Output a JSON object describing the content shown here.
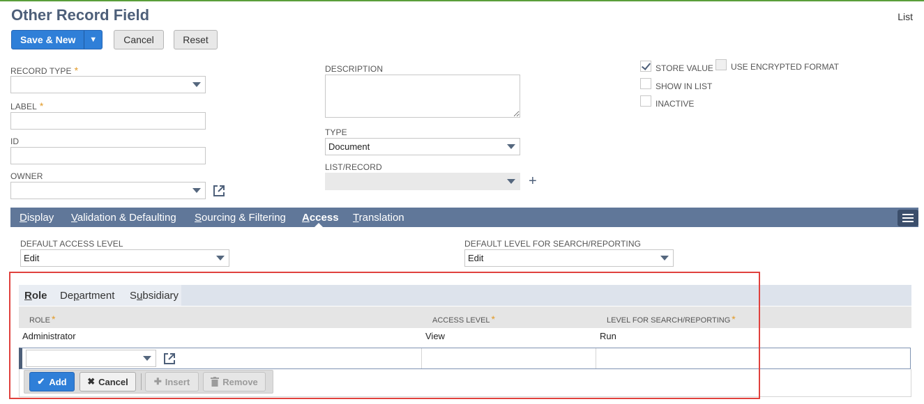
{
  "header": {
    "title": "Other Record Field",
    "list_link": "List"
  },
  "toolbar": {
    "save_new": "Save & New",
    "save_dropdown": "▼",
    "cancel": "Cancel",
    "reset": "Reset"
  },
  "fields": {
    "record_type": {
      "label": "RECORD TYPE",
      "required": "*",
      "value": ""
    },
    "label": {
      "label": "LABEL",
      "required": "*",
      "value": ""
    },
    "id": {
      "label": "ID",
      "value": ""
    },
    "owner": {
      "label": "OWNER",
      "value": ""
    },
    "description": {
      "label": "DESCRIPTION",
      "value": ""
    },
    "type": {
      "label": "TYPE",
      "value": "Document"
    },
    "list_record": {
      "label": "LIST/RECORD",
      "value": ""
    }
  },
  "checkboxes": {
    "store_value": {
      "label": "STORE VALUE",
      "checked": true
    },
    "use_encrypted": {
      "label": "USE ENCRYPTED FORMAT",
      "checked": false
    },
    "show_in_list": {
      "label": "SHOW IN LIST",
      "checked": false
    },
    "inactive": {
      "label": "INACTIVE",
      "checked": false
    }
  },
  "tabs": [
    {
      "first": "D",
      "rest": "isplay"
    },
    {
      "first": "V",
      "rest": "alidation & Defaulting"
    },
    {
      "first": "S",
      "rest": "ourcing & Filtering"
    },
    {
      "first": "A",
      "rest": "ccess"
    },
    {
      "first": "T",
      "rest": "ranslation"
    }
  ],
  "active_tab": "Access",
  "access": {
    "default_access_level": {
      "label": "DEFAULT ACCESS LEVEL",
      "value": "Edit"
    },
    "default_search_level": {
      "label": "DEFAULT LEVEL FOR SEARCH/REPORTING",
      "value": "Edit"
    },
    "subtabs": [
      {
        "first": "R",
        "rest": "ole"
      },
      {
        "pre": "De",
        "u": "p",
        "rest": "artment"
      },
      {
        "pre": "S",
        "u": "u",
        "rest": "bsidiary"
      }
    ],
    "columns": {
      "role": "ROLE",
      "access_level": "ACCESS LEVEL",
      "search_level": "LEVEL FOR SEARCH/REPORTING",
      "required": "*"
    },
    "rows": [
      {
        "role": "Administrator",
        "access_level": "View",
        "search_level": "Run"
      }
    ],
    "machine_buttons": {
      "add": "Add",
      "cancel": "Cancel",
      "insert": "Insert",
      "remove": "Remove"
    }
  },
  "colors": {
    "accent": "#2f7fd8",
    "tabbar": "#607799",
    "highlight": "#e0413d",
    "required": "#e29b29"
  }
}
